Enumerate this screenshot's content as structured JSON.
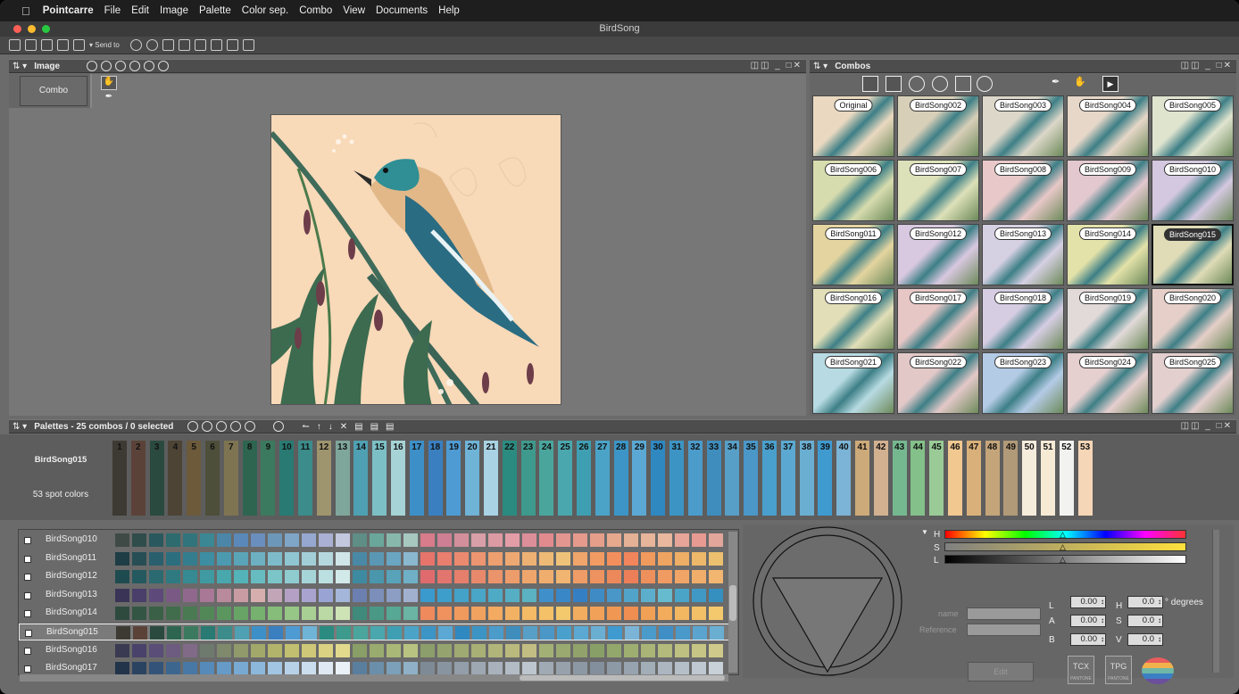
{
  "menubar": {
    "apple": "",
    "app": "Pointcarre",
    "items": [
      "File",
      "Edit",
      "Image",
      "Palette",
      "Color sep.",
      "Combo",
      "View",
      "Documents",
      "Help"
    ]
  },
  "window": {
    "title": "BirdSong"
  },
  "toolbar": {
    "send_to": "Send to"
  },
  "image_panel": {
    "title": "Image",
    "combo_button": "Combo",
    "min_max": "‒",
    "controls": "◫◫ _ □✕"
  },
  "combos_panel": {
    "title": "Combos",
    "controls": "◫◫ _ □✕",
    "thumbs": [
      "Original",
      "BirdSong002",
      "BirdSong003",
      "BirdSong004",
      "BirdSong005",
      "BirdSong006",
      "BirdSong007",
      "BirdSong008",
      "BirdSong009",
      "BirdSong010",
      "BirdSong011",
      "BirdSong012",
      "BirdSong013",
      "BirdSong014",
      "BirdSong015",
      "BirdSong016",
      "BirdSong017",
      "BirdSong018",
      "BirdSong019",
      "BirdSong020",
      "BirdSong021",
      "BirdSong022",
      "BirdSong023",
      "BirdSong024",
      "BirdSong025"
    ],
    "thumb_colors": [
      "#ead9c0",
      "#d8cfb8",
      "#dcd7c9",
      "#e6d7c8",
      "#dfe4cf",
      "#d7dcae",
      "#dde1b9",
      "#e8c8c8",
      "#e3c8cf",
      "#d4c8e0",
      "#e4d5a0",
      "#d8c8e0",
      "#d6d0e3",
      "#e3e2a9",
      "#dfdcb7",
      "#e2dfb8",
      "#e7c7c6",
      "#d6cde3",
      "#e2dad9",
      "#e5cfc8",
      "#b8dbe3",
      "#e3c8c8",
      "#b4cbe6",
      "#e6cfcf",
      "#e4cfcf"
    ],
    "selected": "BirdSong015"
  },
  "palettes_panel": {
    "title": "Palettes - 25 combos / 0 selected",
    "controls": "◫◫ _ □✕",
    "current_combo": "BirdSong015",
    "spot_colors": "53 spot colors",
    "chips": [
      "#3d3a33",
      "#5b4238",
      "#2b4a3f",
      "#4d4436",
      "#6c5a3a",
      "#4e4f3a",
      "#7e7451",
      "#2e6551",
      "#3b7a5e",
      "#297a73",
      "#3b8c8a",
      "#9e946d",
      "#7ea69a",
      "#4fa0b2",
      "#7cc0c6",
      "#a6d3d6",
      "#3d8fc7",
      "#3a7fc0",
      "#4e9bd3",
      "#6fb3d6",
      "#a9d2e4",
      "#2b8b80",
      "#3e9a8c",
      "#4aa69d",
      "#4aa7ad",
      "#3f9fb2",
      "#4ba3c7",
      "#3c95c6",
      "#5aa8d3",
      "#2f88c0",
      "#3c94c4",
      "#4b9bcb",
      "#3e8dbd",
      "#579fc7",
      "#4a97c8",
      "#4aa0cc",
      "#5ba9d2",
      "#6aaed2",
      "#3f9ad0",
      "#7bb4d6",
      "#cdaa7a",
      "#d2b190",
      "#75b890",
      "#84c089",
      "#9acb97",
      "#f0c890",
      "#dab07a",
      "#c4a57a",
      "#b19a78",
      "#f6ecdc",
      "#f6ead5",
      "#f2f2f0",
      "#f5d6b7"
    ]
  },
  "combo_list": {
    "rows": [
      {
        "name": "BirdSong010",
        "colors": [
          "#3f4a46",
          "#2f4d4a",
          "#29585e",
          "#2d6b6e",
          "#31747b",
          "#3b8794",
          "#4b86a8",
          "#5a88b8",
          "#6a8ebd",
          "#6d97b8",
          "#7fa6c6",
          "#96a8d0",
          "#a9b0d3",
          "#c3c8df",
          "#5e8e86",
          "#6aa79a",
          "#88b8ab",
          "#a6c8bf",
          "#d87b8a",
          "#cf7f93",
          "#d38f9b",
          "#d99fa8",
          "#dc9aa3",
          "#e39da7",
          "#dd8f99",
          "#e18b8f",
          "#e3968f",
          "#e59a8c",
          "#e59e8a",
          "#e6a98e",
          "#e4b096",
          "#e7b59a",
          "#e9b89e",
          "#e6a598",
          "#e69a92",
          "#e3a69b"
        ]
      },
      {
        "name": "BirdSong011",
        "colors": [
          "#1f3d45",
          "#274e55",
          "#2a5f6d",
          "#2b6f7f",
          "#337d8e",
          "#3d8ea2",
          "#4c9ab0",
          "#5aa4b8",
          "#6cb0c2",
          "#7ebbca",
          "#8fc6d1",
          "#a2cfd7",
          "#b5d8de",
          "#cfe5e8",
          "#4a89a5",
          "#5a97b4",
          "#6aa6c2",
          "#8ab8cf",
          "#e6746b",
          "#ea7e6f",
          "#ec8a6f",
          "#ed9570",
          "#ee9f70",
          "#eea872",
          "#eeb174",
          "#efba76",
          "#efc27a",
          "#f0a56b",
          "#f29b63",
          "#f38f5c",
          "#f2855b",
          "#f09a5d",
          "#efa461",
          "#eeae66",
          "#edb86a",
          "#ecc06f"
        ]
      },
      {
        "name": "BirdSong012",
        "colors": [
          "#1e4b4f",
          "#245a5f",
          "#2a6a70",
          "#2f7a81",
          "#368a91",
          "#3f9aa1",
          "#48a8ae",
          "#54b3b8",
          "#67bcc1",
          "#7bc5c9",
          "#8fccd0",
          "#a6d5d8",
          "#bcdfe1",
          "#d2e9ea",
          "#3e8aa0",
          "#4a96ad",
          "#58a3ba",
          "#6fb0c6",
          "#e06b6e",
          "#e2756d",
          "#e57f6c",
          "#e8896b",
          "#eb936b",
          "#ed9d6b",
          "#efa66c",
          "#f0ae6e",
          "#f1b571",
          "#ef9c66",
          "#ee9260",
          "#ed885b",
          "#ec7f58",
          "#ee905c",
          "#ef9b61",
          "#f0a566",
          "#f1ae6b",
          "#f2b670"
        ]
      },
      {
        "name": "BirdSong013",
        "colors": [
          "#3a3557",
          "#4a3e6a",
          "#5e4a7a",
          "#7a5a84",
          "#90688e",
          "#a87896",
          "#b88a9c",
          "#c99ca3",
          "#d7aeae",
          "#c2a6b8",
          "#b4a0c4",
          "#a9a3cf",
          "#9aa4d4",
          "#a4b6d9",
          "#6b80b0",
          "#7b8fba",
          "#8c9ec4",
          "#a1b0ce",
          "#3b9acd",
          "#3e9ecb",
          "#44a2c9",
          "#49a6c7",
          "#4faac6",
          "#55aec4",
          "#5bb2c2",
          "#3f8fcb",
          "#3a87c8",
          "#347fc4",
          "#3e8bc6",
          "#4897c8",
          "#52a3ca",
          "#5cafcc",
          "#66bbce",
          "#4aa4c8",
          "#3f99c4",
          "#3590c0"
        ]
      },
      {
        "name": "BirdSong014",
        "colors": [
          "#2e4a3f",
          "#335543",
          "#3a6147",
          "#416d4c",
          "#497a52",
          "#528858",
          "#5c965f",
          "#68a466",
          "#76b16f",
          "#86bd7a",
          "#97c786",
          "#a9d094",
          "#bbd9a4",
          "#cde2b5",
          "#3f8a7a",
          "#4a9987",
          "#57a894",
          "#6ab5a3",
          "#ef8a5c",
          "#f0925d",
          "#f19a5e",
          "#f2a25f",
          "#f3aa61",
          "#f3b263",
          "#f4ba65",
          "#f4c168",
          "#f4c86c",
          "#f3ad5e",
          "#f2a258",
          "#f09853",
          "#ef8e50",
          "#f1a155",
          "#f2ac5b",
          "#f3b661",
          "#f4c067",
          "#f4c96d"
        ]
      },
      {
        "name": "BirdSong015",
        "colors": [
          "#3d3a33",
          "#5b4238",
          "#2b4a3f",
          "#2e6551",
          "#3b7a5e",
          "#297a73",
          "#3b8c8a",
          "#4fa0b2",
          "#3d8fc7",
          "#3a7fc0",
          "#4e9bd3",
          "#6fb3d6",
          "#2b8b80",
          "#3e9a8c",
          "#4aa69d",
          "#4aa7ad",
          "#3f9fb2",
          "#4ba3c7",
          "#3c95c6",
          "#5aa8d3",
          "#2f88c0",
          "#3c94c4",
          "#4b9bcb",
          "#3e8dbd",
          "#579fc7",
          "#4a97c8",
          "#4aa0cc",
          "#5ba9d2",
          "#6aaed2",
          "#3f9ad0",
          "#7bb4d6",
          "#4a9bcc",
          "#3f8fc6",
          "#4a99cb",
          "#5aa4cf",
          "#6aaed2"
        ]
      },
      {
        "name": "BirdSong016",
        "colors": [
          "#3a3a52",
          "#49426a",
          "#5a4d78",
          "#6d5b80",
          "#806a88",
          "#6e7a6e",
          "#7f8a6c",
          "#909a6a",
          "#a2a86a",
          "#b2b46c",
          "#c2bf71",
          "#cfc878",
          "#dad182",
          "#e3d98d",
          "#8a9e68",
          "#9aab6f",
          "#a9b877",
          "#b9c381",
          "#8c9e6b",
          "#95a46e",
          "#9faa72",
          "#a8b076",
          "#b1b57a",
          "#bab97e",
          "#c2be83",
          "#a3b075",
          "#9aa970",
          "#91a26b",
          "#88a067",
          "#93a76c",
          "#9eae71",
          "#a9b476",
          "#b3ba7b",
          "#bdc080",
          "#c6c585",
          "#cfca8b"
        ]
      },
      {
        "name": "BirdSong017",
        "colors": [
          "#22344a",
          "#2a4361",
          "#335478",
          "#3d668f",
          "#4878a5",
          "#568ab8",
          "#669ac7",
          "#78a9d3",
          "#8cb8dc",
          "#a1c5e2",
          "#b7d2e8",
          "#cbdeee",
          "#dee9f3",
          "#eaf1f7",
          "#5a7f9e",
          "#6b8fab",
          "#7ca0b9",
          "#8fb0c6",
          "#7e8a96",
          "#8894a0",
          "#939eaa",
          "#9ea8b3",
          "#a9b2bc",
          "#b3bcc5",
          "#bdc6ce",
          "#a0aab4",
          "#96a1ac",
          "#8c98a4",
          "#838f9c",
          "#8d99a5",
          "#97a3ae",
          "#a1adb7",
          "#abb6c0",
          "#b5bfc8",
          "#bfc8d0",
          "#c9d1d8"
        ]
      }
    ]
  },
  "color_editor": {
    "h_label": "H",
    "s_label": "S",
    "l_label": "L",
    "name_label": "name",
    "reference_label": "Reference",
    "edit_label": "Edit",
    "lab_L": "0.00",
    "lab_A": "0.00",
    "lab_B": "0.00",
    "hsv_H": "0.0",
    "hsv_S": "0.0",
    "hsv_V": "0.0",
    "L": "L",
    "A": "A",
    "B": "B",
    "H": "H",
    "S": "S",
    "V": "V",
    "degrees": "° degrees",
    "tcx": "TCX",
    "tpg": "TPG",
    "pantone": "PANTONE"
  },
  "colors": {
    "menubar": "#1e1e1e",
    "panel_bg": "#6b6b6b",
    "artboard": "#f8d9b8",
    "selection": "#111111"
  }
}
